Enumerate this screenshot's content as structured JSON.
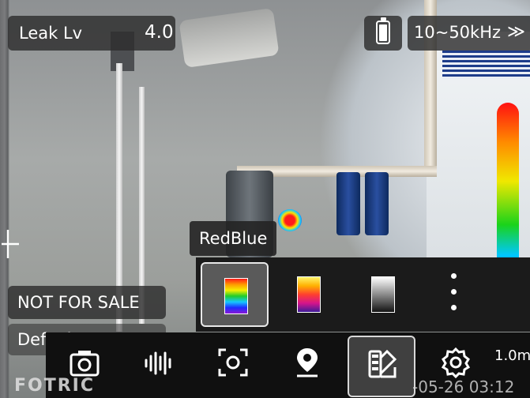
{
  "status": {
    "leak_label": "Leak Lv",
    "leak_value": "4.0",
    "battery_level": 0.8,
    "frequency_range": "10~50kHz",
    "frequency_chevron": "≫"
  },
  "overlay": {
    "watermark": "NOT FOR SALE",
    "preset": "Default",
    "distance": "1.0m",
    "timestamp": "-05-26 03:12",
    "brand_logo": "FOTRIC"
  },
  "palette_menu": {
    "selected_name": "RedBlue",
    "options": [
      {
        "name": "rainbow-palette",
        "selected": true
      },
      {
        "name": "iron-palette",
        "selected": false
      },
      {
        "name": "grayscale-palette",
        "selected": false
      }
    ],
    "more_icon": "more-vertical-icon"
  },
  "toolbar": {
    "items": [
      {
        "icon": "camera-icon",
        "selected": false
      },
      {
        "icon": "audio-wave-icon",
        "selected": false
      },
      {
        "icon": "focus-scan-icon",
        "selected": false
      },
      {
        "icon": "location-pin-icon",
        "selected": false
      },
      {
        "icon": "palette-icon",
        "selected": true
      },
      {
        "icon": "settings-icon",
        "selected": false
      }
    ]
  },
  "colors": {
    "scale_top": "#ff1111",
    "scale_bottom": "#8a11d8",
    "panel_bg": "#1b1b1b"
  }
}
